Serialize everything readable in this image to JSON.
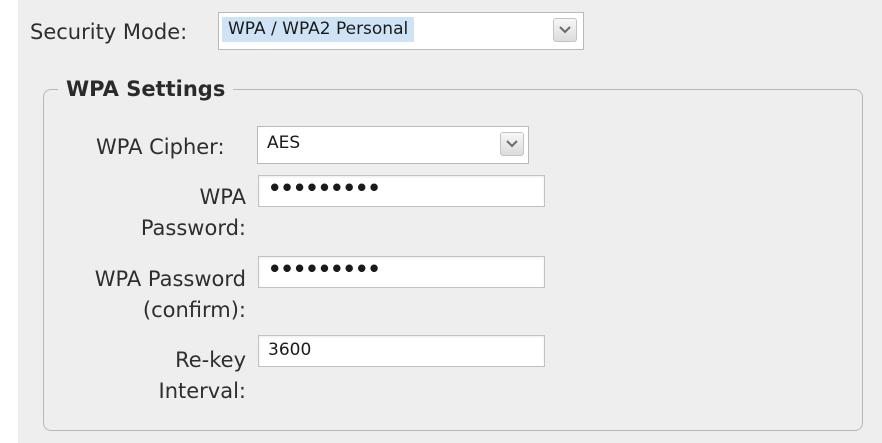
{
  "security_mode": {
    "label": "Security Mode:",
    "value": "WPA / WPA2 Personal"
  },
  "wpa_settings": {
    "legend": "WPA Settings",
    "cipher": {
      "label": "WPA Cipher:",
      "value": "AES"
    },
    "password": {
      "label_line1": "WPA",
      "label_line2": "Password:",
      "value": "•••••••••"
    },
    "password_confirm": {
      "label_line1": "WPA Password",
      "label_line2": "(confirm):",
      "value": "•••••••••"
    },
    "rekey_interval": {
      "label_line1": "Re-key",
      "label_line2": "Interval:",
      "value": "3600"
    }
  },
  "icons": {
    "dropdown": "chevron-down-icon"
  },
  "colors": {
    "panel_background": "#eeeeee",
    "selection_highlight": "#cfe3f7"
  }
}
